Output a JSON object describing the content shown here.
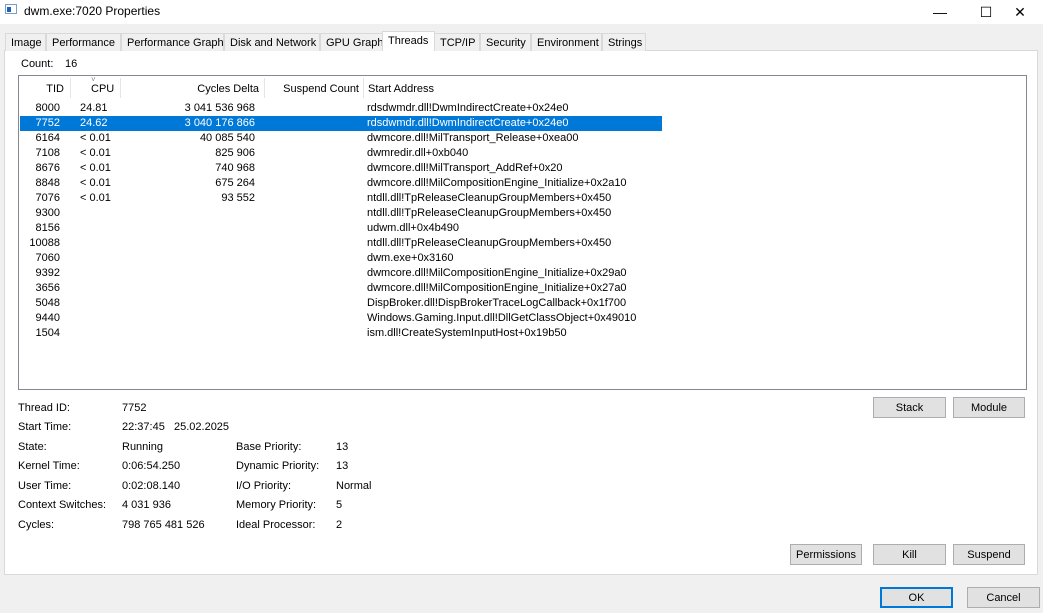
{
  "window": {
    "title": "dwm.exe:7020 Properties",
    "minimize": "—",
    "maximize": "☐",
    "close": "✕"
  },
  "tabs": [
    {
      "label": "Image"
    },
    {
      "label": "Performance"
    },
    {
      "label": "Performance Graph"
    },
    {
      "label": "Disk and Network"
    },
    {
      "label": "GPU Graph"
    },
    {
      "label": "Threads",
      "active": true
    },
    {
      "label": "TCP/IP"
    },
    {
      "label": "Security"
    },
    {
      "label": "Environment"
    },
    {
      "label": "Strings"
    }
  ],
  "count": {
    "label": "Count:",
    "value": "16"
  },
  "columns": {
    "tid": "TID",
    "cpu": "CPU",
    "cycles": "Cycles Delta",
    "suspend": "Suspend Count",
    "start": "Start Address",
    "sort_column": "CPU"
  },
  "threads": [
    {
      "tid": "8000",
      "cpu": "24.81",
      "cycles": "3 041 536 968",
      "start": "rdsdwmdr.dll!DwmIndirectCreate+0x24e0"
    },
    {
      "tid": "7752",
      "cpu": "24.62",
      "cycles": "3 040 176 866",
      "start": "rdsdwmdr.dll!DwmIndirectCreate+0x24e0",
      "selected": true
    },
    {
      "tid": "6164",
      "cpu": "< 0.01",
      "cycles": "40 085 540",
      "start": "dwmcore.dll!MilTransport_Release+0xea00"
    },
    {
      "tid": "7108",
      "cpu": "< 0.01",
      "cycles": "825 906",
      "start": "dwmredir.dll+0xb040"
    },
    {
      "tid": "8676",
      "cpu": "< 0.01",
      "cycles": "740 968",
      "start": "dwmcore.dll!MilTransport_AddRef+0x20"
    },
    {
      "tid": "8848",
      "cpu": "< 0.01",
      "cycles": "675 264",
      "start": "dwmcore.dll!MilCompositionEngine_Initialize+0x2a10"
    },
    {
      "tid": "7076",
      "cpu": "< 0.01",
      "cycles": "93 552",
      "start": "ntdll.dll!TpReleaseCleanupGroupMembers+0x450"
    },
    {
      "tid": "9300",
      "cpu": "",
      "cycles": "",
      "start": "ntdll.dll!TpReleaseCleanupGroupMembers+0x450"
    },
    {
      "tid": "8156",
      "cpu": "",
      "cycles": "",
      "start": "udwm.dll+0x4b490"
    },
    {
      "tid": "10088",
      "cpu": "",
      "cycles": "",
      "start": "ntdll.dll!TpReleaseCleanupGroupMembers+0x450"
    },
    {
      "tid": "7060",
      "cpu": "",
      "cycles": "",
      "start": "dwm.exe+0x3160"
    },
    {
      "tid": "9392",
      "cpu": "",
      "cycles": "",
      "start": "dwmcore.dll!MilCompositionEngine_Initialize+0x29a0"
    },
    {
      "tid": "3656",
      "cpu": "",
      "cycles": "",
      "start": "dwmcore.dll!MilCompositionEngine_Initialize+0x27a0"
    },
    {
      "tid": "5048",
      "cpu": "",
      "cycles": "",
      "start": "DispBroker.dll!DispBrokerTraceLogCallback+0x1f700"
    },
    {
      "tid": "9440",
      "cpu": "",
      "cycles": "",
      "start": "Windows.Gaming.Input.dll!DllGetClassObject+0x49010"
    },
    {
      "tid": "1504",
      "cpu": "",
      "cycles": "",
      "start": "ism.dll!CreateSystemInputHost+0x19b50"
    }
  ],
  "details": {
    "thread_id": {
      "label": "Thread ID:",
      "value": "7752"
    },
    "start_time": {
      "label": "Start Time:",
      "value": "22:37:45   25.02.2025"
    },
    "state": {
      "label": "State:",
      "value": "Running"
    },
    "kernel_time": {
      "label": "Kernel Time:",
      "value": "0:06:54.250"
    },
    "user_time": {
      "label": "User Time:",
      "value": "0:02:08.140"
    },
    "context_switches": {
      "label": "Context Switches:",
      "value": "4 031 936"
    },
    "cycles": {
      "label": "Cycles:",
      "value": "798 765 481 526"
    },
    "base_priority": {
      "label": "Base Priority:",
      "value": "13"
    },
    "dynamic_priority": {
      "label": "Dynamic Priority:",
      "value": "13"
    },
    "io_priority": {
      "label": "I/O Priority:",
      "value": "Normal"
    },
    "memory_priority": {
      "label": "Memory Priority:",
      "value": "5"
    },
    "ideal_processor": {
      "label": "Ideal Processor:",
      "value": "2"
    }
  },
  "buttons": {
    "stack": "Stack",
    "module": "Module",
    "permissions": "Permissions",
    "kill": "Kill",
    "suspend": "Suspend",
    "ok": "OK",
    "cancel": "Cancel"
  }
}
